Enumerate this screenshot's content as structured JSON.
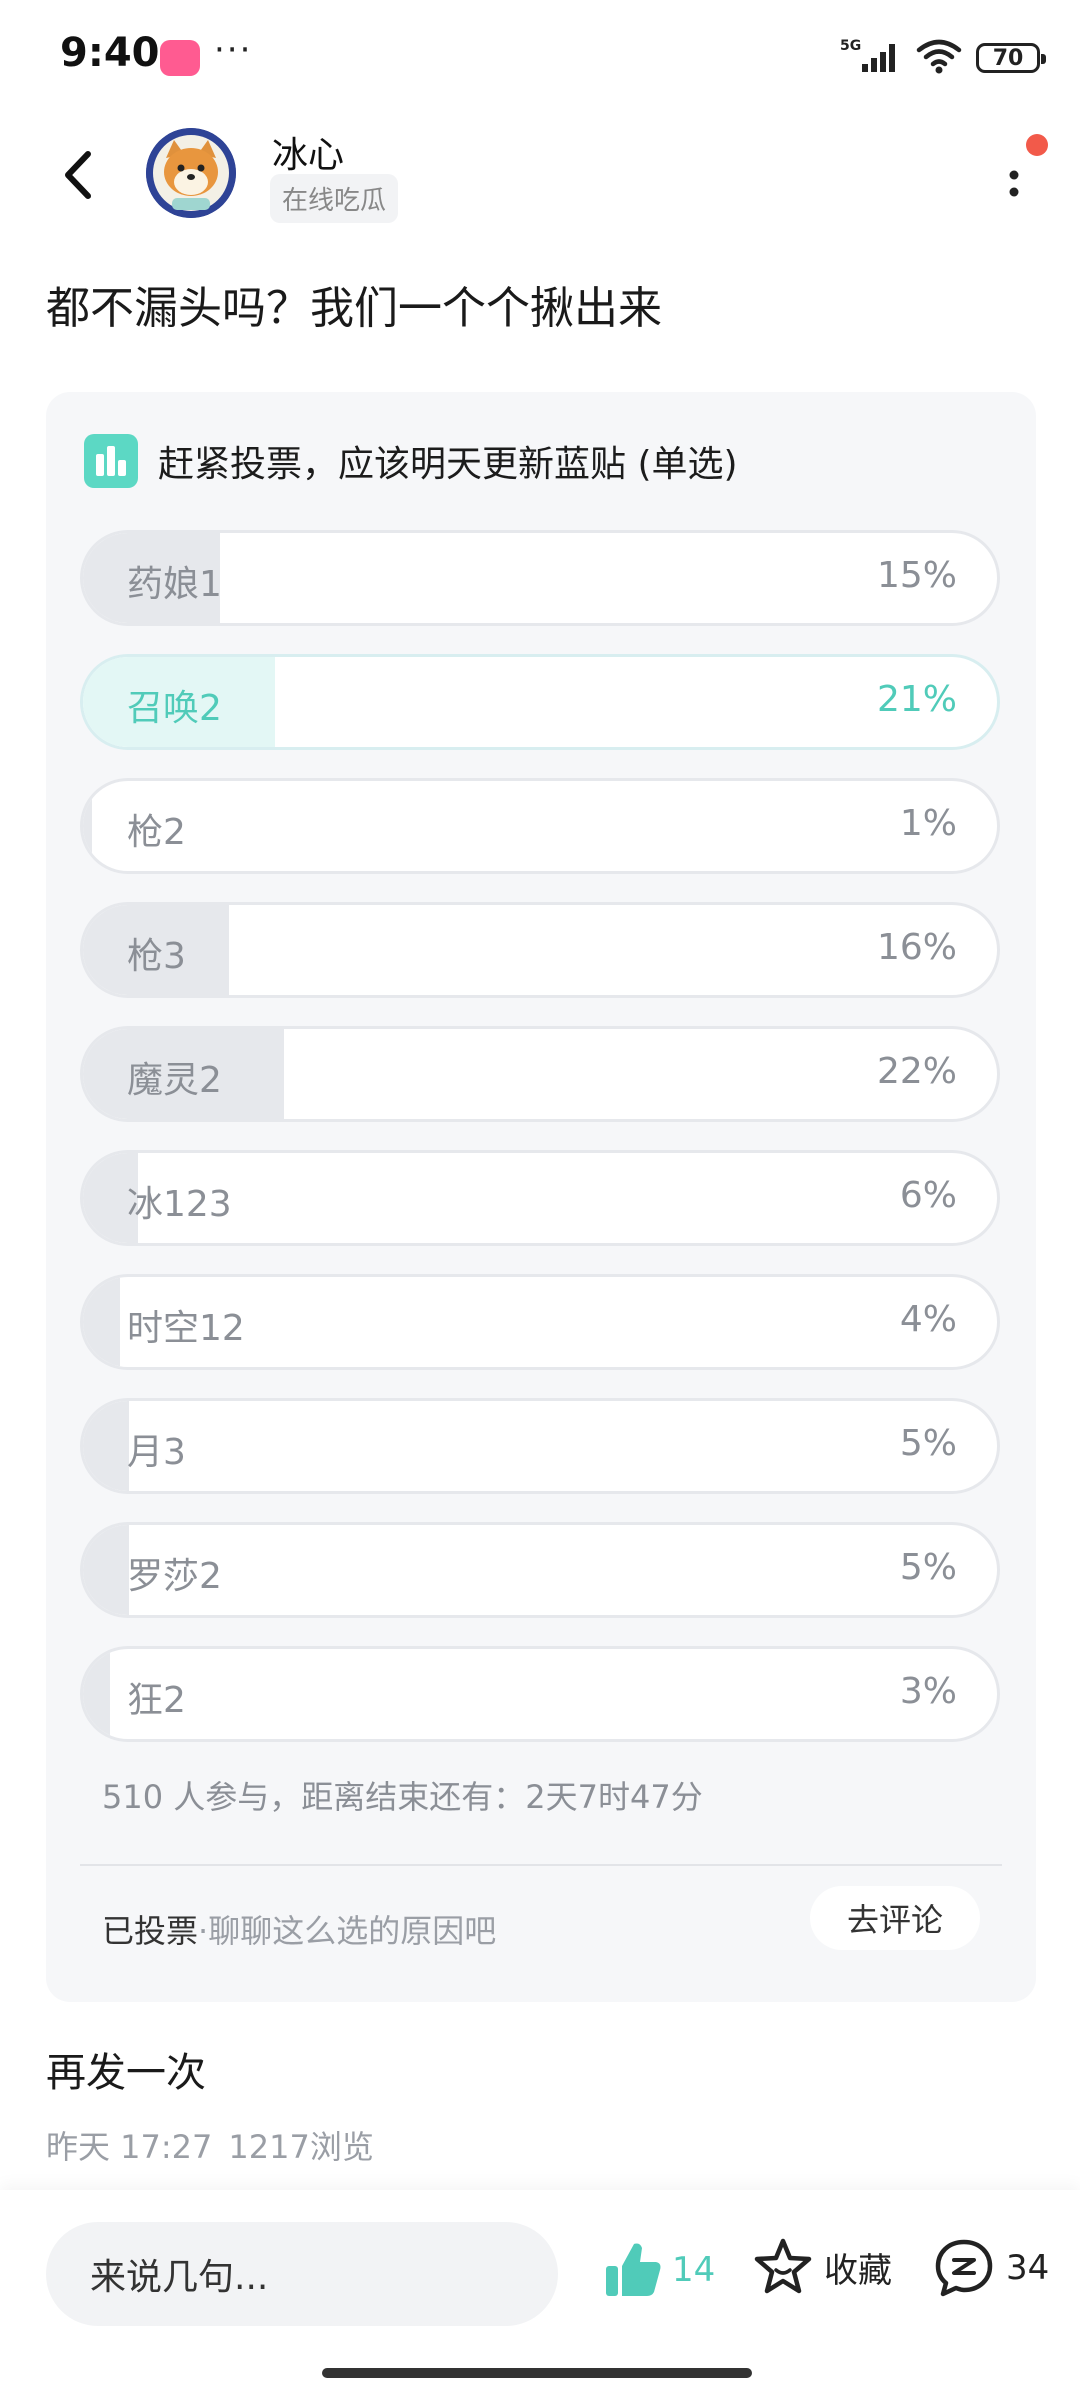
{
  "status_bar": {
    "time": "9:40",
    "dots": "···",
    "network": "5G",
    "battery": "70"
  },
  "header": {
    "author_name": "冰心",
    "author_tag": "在线吃瓜"
  },
  "post": {
    "title": "都不漏头吗？我们一个个揪出来",
    "body": "再发一次",
    "time": "昨天 17:27",
    "views": "1217浏览"
  },
  "poll": {
    "title": "赶紧投票，应该明天更新蓝贴 (单选)",
    "options": [
      {
        "label": "药娘1",
        "percent": "15%",
        "fill": 15
      },
      {
        "label": "召唤2",
        "percent": "21%",
        "fill": 21,
        "selected": true
      },
      {
        "label": "枪2",
        "percent": "1%",
        "fill": 1
      },
      {
        "label": "枪3",
        "percent": "16%",
        "fill": 16
      },
      {
        "label": "魔灵2",
        "percent": "22%",
        "fill": 22
      },
      {
        "label": "冰123",
        "percent": "6%",
        "fill": 6
      },
      {
        "label": "时空12",
        "percent": "4%",
        "fill": 4
      },
      {
        "label": "月3",
        "percent": "5%",
        "fill": 5
      },
      {
        "label": "罗莎2",
        "percent": "5%",
        "fill": 5
      },
      {
        "label": "狂2",
        "percent": "3%",
        "fill": 3
      }
    ],
    "stats": "510 人参与，距离结束还有：2天7时47分",
    "voted_label": "已投票",
    "voted_hint": "·聊聊这么选的原因吧",
    "comment_button": "去评论"
  },
  "bottom_bar": {
    "input_placeholder": "来说几句...",
    "like_count": "14",
    "favorite_label": "收藏",
    "comment_count": "34"
  },
  "colors": {
    "accent": "#50cbb9",
    "selected_fill": "#e3f7f5",
    "bar_fill": "#e6e8ec",
    "notify": "#f25a4a"
  },
  "icons": {
    "back": "chevron-left-icon",
    "more": "more-vertical-icon",
    "poll": "bar-chart-icon",
    "like": "thumbs-up-icon",
    "favorite": "star-icon",
    "comment": "chat-bubble-icon",
    "signal": "cellular-signal-icon",
    "wifi": "wifi-icon",
    "battery": "battery-icon"
  }
}
